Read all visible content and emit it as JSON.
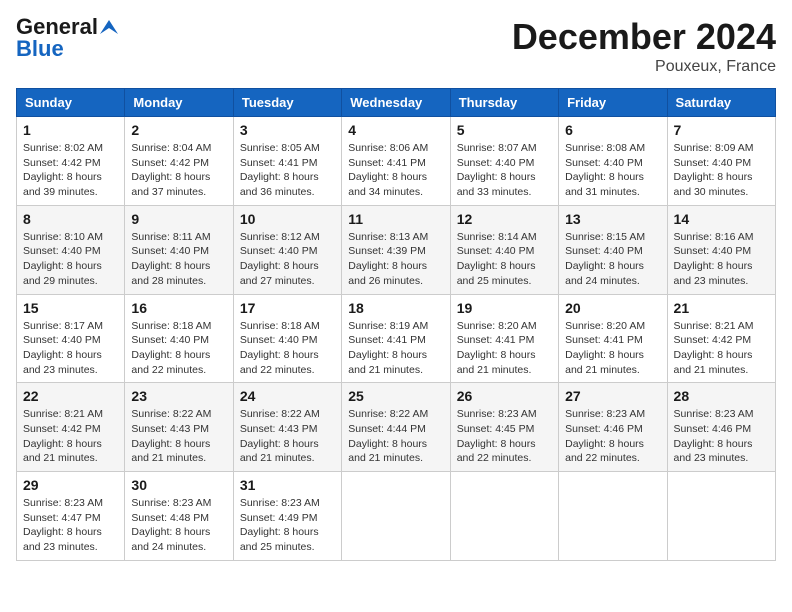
{
  "header": {
    "logo_general": "General",
    "logo_blue": "Blue",
    "month_title": "December 2024",
    "location": "Pouxeux, France"
  },
  "weekdays": [
    "Sunday",
    "Monday",
    "Tuesday",
    "Wednesday",
    "Thursday",
    "Friday",
    "Saturday"
  ],
  "weeks": [
    [
      {
        "day": "1",
        "sunrise": "Sunrise: 8:02 AM",
        "sunset": "Sunset: 4:42 PM",
        "daylight": "Daylight: 8 hours and 39 minutes."
      },
      {
        "day": "2",
        "sunrise": "Sunrise: 8:04 AM",
        "sunset": "Sunset: 4:42 PM",
        "daylight": "Daylight: 8 hours and 37 minutes."
      },
      {
        "day": "3",
        "sunrise": "Sunrise: 8:05 AM",
        "sunset": "Sunset: 4:41 PM",
        "daylight": "Daylight: 8 hours and 36 minutes."
      },
      {
        "day": "4",
        "sunrise": "Sunrise: 8:06 AM",
        "sunset": "Sunset: 4:41 PM",
        "daylight": "Daylight: 8 hours and 34 minutes."
      },
      {
        "day": "5",
        "sunrise": "Sunrise: 8:07 AM",
        "sunset": "Sunset: 4:40 PM",
        "daylight": "Daylight: 8 hours and 33 minutes."
      },
      {
        "day": "6",
        "sunrise": "Sunrise: 8:08 AM",
        "sunset": "Sunset: 4:40 PM",
        "daylight": "Daylight: 8 hours and 31 minutes."
      },
      {
        "day": "7",
        "sunrise": "Sunrise: 8:09 AM",
        "sunset": "Sunset: 4:40 PM",
        "daylight": "Daylight: 8 hours and 30 minutes."
      }
    ],
    [
      {
        "day": "8",
        "sunrise": "Sunrise: 8:10 AM",
        "sunset": "Sunset: 4:40 PM",
        "daylight": "Daylight: 8 hours and 29 minutes."
      },
      {
        "day": "9",
        "sunrise": "Sunrise: 8:11 AM",
        "sunset": "Sunset: 4:40 PM",
        "daylight": "Daylight: 8 hours and 28 minutes."
      },
      {
        "day": "10",
        "sunrise": "Sunrise: 8:12 AM",
        "sunset": "Sunset: 4:40 PM",
        "daylight": "Daylight: 8 hours and 27 minutes."
      },
      {
        "day": "11",
        "sunrise": "Sunrise: 8:13 AM",
        "sunset": "Sunset: 4:39 PM",
        "daylight": "Daylight: 8 hours and 26 minutes."
      },
      {
        "day": "12",
        "sunrise": "Sunrise: 8:14 AM",
        "sunset": "Sunset: 4:40 PM",
        "daylight": "Daylight: 8 hours and 25 minutes."
      },
      {
        "day": "13",
        "sunrise": "Sunrise: 8:15 AM",
        "sunset": "Sunset: 4:40 PM",
        "daylight": "Daylight: 8 hours and 24 minutes."
      },
      {
        "day": "14",
        "sunrise": "Sunrise: 8:16 AM",
        "sunset": "Sunset: 4:40 PM",
        "daylight": "Daylight: 8 hours and 23 minutes."
      }
    ],
    [
      {
        "day": "15",
        "sunrise": "Sunrise: 8:17 AM",
        "sunset": "Sunset: 4:40 PM",
        "daylight": "Daylight: 8 hours and 23 minutes."
      },
      {
        "day": "16",
        "sunrise": "Sunrise: 8:18 AM",
        "sunset": "Sunset: 4:40 PM",
        "daylight": "Daylight: 8 hours and 22 minutes."
      },
      {
        "day": "17",
        "sunrise": "Sunrise: 8:18 AM",
        "sunset": "Sunset: 4:40 PM",
        "daylight": "Daylight: 8 hours and 22 minutes."
      },
      {
        "day": "18",
        "sunrise": "Sunrise: 8:19 AM",
        "sunset": "Sunset: 4:41 PM",
        "daylight": "Daylight: 8 hours and 21 minutes."
      },
      {
        "day": "19",
        "sunrise": "Sunrise: 8:20 AM",
        "sunset": "Sunset: 4:41 PM",
        "daylight": "Daylight: 8 hours and 21 minutes."
      },
      {
        "day": "20",
        "sunrise": "Sunrise: 8:20 AM",
        "sunset": "Sunset: 4:41 PM",
        "daylight": "Daylight: 8 hours and 21 minutes."
      },
      {
        "day": "21",
        "sunrise": "Sunrise: 8:21 AM",
        "sunset": "Sunset: 4:42 PM",
        "daylight": "Daylight: 8 hours and 21 minutes."
      }
    ],
    [
      {
        "day": "22",
        "sunrise": "Sunrise: 8:21 AM",
        "sunset": "Sunset: 4:42 PM",
        "daylight": "Daylight: 8 hours and 21 minutes."
      },
      {
        "day": "23",
        "sunrise": "Sunrise: 8:22 AM",
        "sunset": "Sunset: 4:43 PM",
        "daylight": "Daylight: 8 hours and 21 minutes."
      },
      {
        "day": "24",
        "sunrise": "Sunrise: 8:22 AM",
        "sunset": "Sunset: 4:43 PM",
        "daylight": "Daylight: 8 hours and 21 minutes."
      },
      {
        "day": "25",
        "sunrise": "Sunrise: 8:22 AM",
        "sunset": "Sunset: 4:44 PM",
        "daylight": "Daylight: 8 hours and 21 minutes."
      },
      {
        "day": "26",
        "sunrise": "Sunrise: 8:23 AM",
        "sunset": "Sunset: 4:45 PM",
        "daylight": "Daylight: 8 hours and 22 minutes."
      },
      {
        "day": "27",
        "sunrise": "Sunrise: 8:23 AM",
        "sunset": "Sunset: 4:46 PM",
        "daylight": "Daylight: 8 hours and 22 minutes."
      },
      {
        "day": "28",
        "sunrise": "Sunrise: 8:23 AM",
        "sunset": "Sunset: 4:46 PM",
        "daylight": "Daylight: 8 hours and 23 minutes."
      }
    ],
    [
      {
        "day": "29",
        "sunrise": "Sunrise: 8:23 AM",
        "sunset": "Sunset: 4:47 PM",
        "daylight": "Daylight: 8 hours and 23 minutes."
      },
      {
        "day": "30",
        "sunrise": "Sunrise: 8:23 AM",
        "sunset": "Sunset: 4:48 PM",
        "daylight": "Daylight: 8 hours and 24 minutes."
      },
      {
        "day": "31",
        "sunrise": "Sunrise: 8:23 AM",
        "sunset": "Sunset: 4:49 PM",
        "daylight": "Daylight: 8 hours and 25 minutes."
      },
      null,
      null,
      null,
      null
    ]
  ]
}
